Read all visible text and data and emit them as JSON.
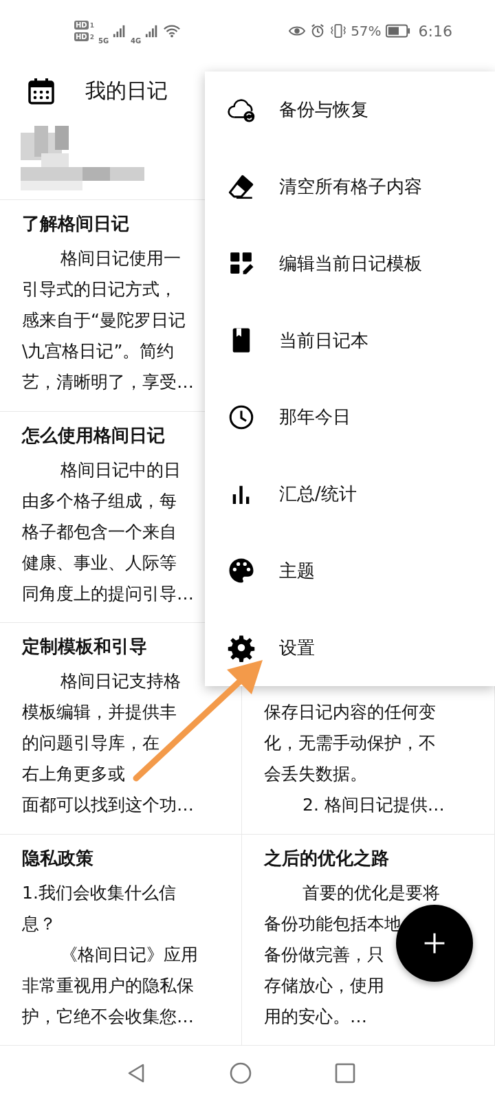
{
  "status_bar": {
    "sims": [
      {
        "label": "HD",
        "slot": "1"
      },
      {
        "label": "HD",
        "slot": "2"
      }
    ],
    "networks": [
      "5G",
      "4G"
    ],
    "battery_text": "57%",
    "time": "6:16"
  },
  "app_bar": {
    "title": "我的日记"
  },
  "cards": [
    {
      "title": "了解格间日记",
      "lines": [
        {
          "text": "格间日记使用一",
          "indent": true
        },
        {
          "text": "引导式的日记方式，",
          "indent": false
        },
        {
          "text": "感来自于“曼陀罗日记",
          "indent": false
        },
        {
          "text": "\\九宫格日记”。简约",
          "indent": false
        },
        {
          "text": "艺，清晰明了，享受…",
          "indent": false
        }
      ]
    },
    {
      "title": "怎么使用格间日记",
      "lines": [
        {
          "text": "格间日记中的日",
          "indent": true
        },
        {
          "text": "由多个格子组成，每",
          "indent": false
        },
        {
          "text": "格子都包含一个来自",
          "indent": false
        },
        {
          "text": "健康、事业、人际等",
          "indent": false
        },
        {
          "text": "同角度上的提问引导…",
          "indent": false
        }
      ]
    },
    {
      "title": "定制模板和引导",
      "lines": [
        {
          "text": "格间日记支持格",
          "indent": true
        },
        {
          "text": "模板编辑，并提供丰",
          "indent": false
        },
        {
          "text": "的问题引导库，在",
          "indent": false
        },
        {
          "text": "右上角更多或",
          "indent": false
        },
        {
          "text": "面都可以找到这个功…",
          "indent": false
        }
      ]
    },
    {
      "lines": [
        {
          "text": "保存日记内容的任何变",
          "indent": false
        },
        {
          "text": "化，无需手动保护，不",
          "indent": false
        },
        {
          "text": "会丢失数据。",
          "indent": false
        },
        {
          "text": "2. 格间日记提供…",
          "indent": true
        }
      ]
    },
    {
      "title": "隐私政策",
      "lines": [
        {
          "text": "1.我们会收集什么信",
          "indent": false
        },
        {
          "text": "息？",
          "indent": false
        },
        {
          "text": "《格间日记》应用",
          "indent": true
        },
        {
          "text": "非常重视用户的隐私保",
          "indent": false
        },
        {
          "text": "护，它绝不会收集您…",
          "indent": false
        }
      ]
    },
    {
      "title": "之后的优化之路",
      "lines": [
        {
          "text": "首要的优化是要将",
          "indent": true
        },
        {
          "text": "备份功能包括本地",
          "indent": false
        },
        {
          "text": "备份做完善，只",
          "indent": false
        },
        {
          "text": "存储放心，使用",
          "indent": false
        },
        {
          "text": "用的安心。…",
          "indent": false
        }
      ]
    }
  ],
  "menu": {
    "items": [
      "备份与恢复",
      "清空所有格子内容",
      "编辑当前日记模板",
      "当前日记本",
      "那年今日",
      "汇总/统计",
      "主题",
      "设置"
    ]
  }
}
